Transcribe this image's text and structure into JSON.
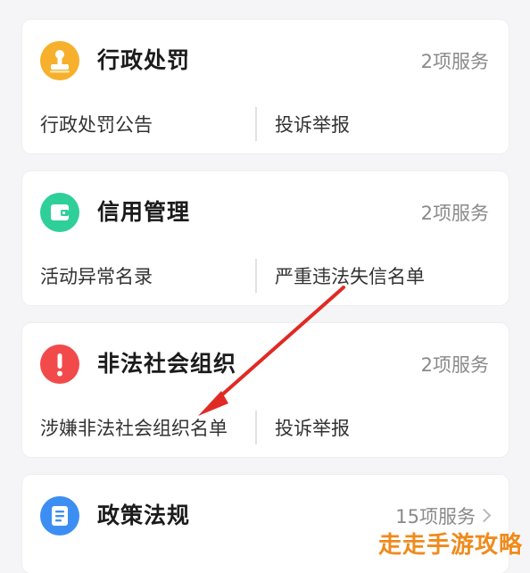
{
  "colors": {
    "penalty_icon": "#f6b02c",
    "credit_icon": "#2fcf99",
    "illegal_icon": "#f24a4a",
    "policy_icon": "#3d8ef2",
    "annotation_arrow": "#e02a24",
    "watermark": "#f08a1c"
  },
  "cards": [
    {
      "title": "行政处罚",
      "count": "2项服务",
      "icon": "stamp-icon",
      "links": [
        "行政处罚公告",
        "投诉举报"
      ]
    },
    {
      "title": "信用管理",
      "count": "2项服务",
      "icon": "wallet-icon",
      "links": [
        "活动异常名录",
        "严重违法失信名单"
      ]
    },
    {
      "title": "非法社会组织",
      "count": "2项服务",
      "icon": "exclamation-icon",
      "links": [
        "涉嫌非法社会组织名单",
        "投诉举报"
      ]
    },
    {
      "title": "政策法规",
      "count": "15项服务",
      "icon": "document-icon"
    }
  ],
  "watermark": "走走手游攻略"
}
